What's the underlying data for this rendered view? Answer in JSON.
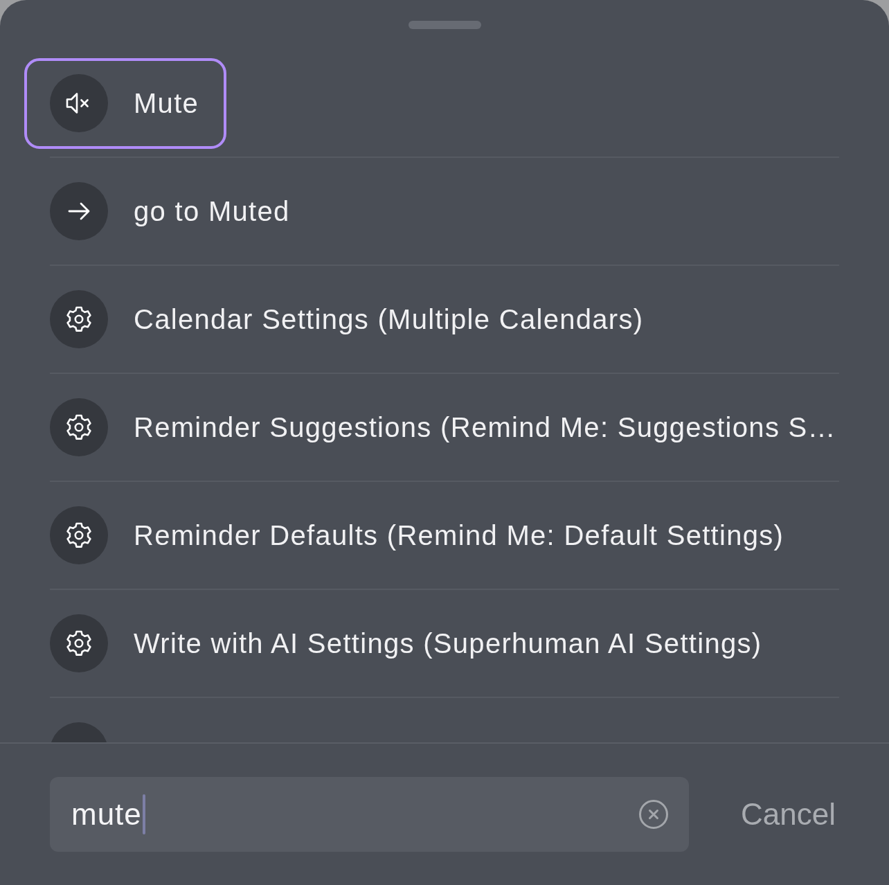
{
  "results": [
    {
      "kind": "mute",
      "label": "Mute",
      "selected": true
    },
    {
      "kind": "arrow",
      "label": "go to Muted",
      "selected": false
    },
    {
      "kind": "settings",
      "label": "Calendar Settings (Multiple Calendars)",
      "selected": false
    },
    {
      "kind": "settings",
      "label": "Reminder Suggestions (Remind Me: Suggestions S…",
      "selected": false
    },
    {
      "kind": "settings",
      "label": "Reminder Defaults (Remind Me: Default Settings)",
      "selected": false
    },
    {
      "kind": "settings",
      "label": "Write with AI Settings (Superhuman AI Settings)",
      "selected": false
    },
    {
      "kind": "hidden",
      "selected": false
    }
  ],
  "search_bar": {
    "search": {
      "value": "mute",
      "focused": true
    },
    "cancel_button": "Cancel"
  }
}
